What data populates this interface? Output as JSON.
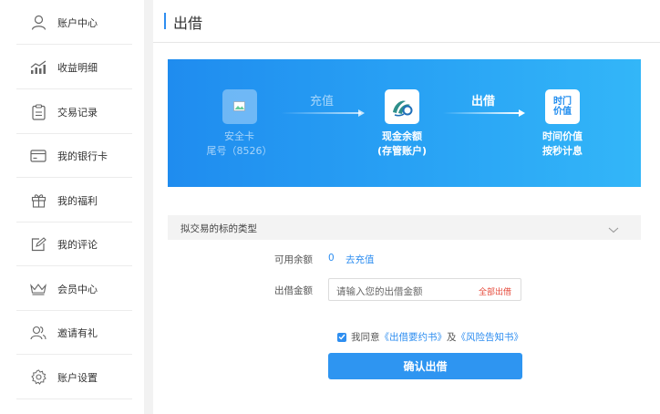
{
  "sidebar": {
    "items": [
      {
        "label": "账户中心",
        "icon": "user-icon"
      },
      {
        "label": "收益明细",
        "icon": "chart-icon"
      },
      {
        "label": "交易记录",
        "icon": "clipboard-icon"
      },
      {
        "label": "我的银行卡",
        "icon": "card-icon"
      },
      {
        "label": "我的福利",
        "icon": "gift-icon"
      },
      {
        "label": "我的评论",
        "icon": "edit-icon"
      },
      {
        "label": "会员中心",
        "icon": "crown-icon"
      },
      {
        "label": "邀请有礼",
        "icon": "users-icon"
      },
      {
        "label": "账户设置",
        "icon": "gear-icon"
      }
    ]
  },
  "header": {
    "title": "出借"
  },
  "banner": {
    "card": {
      "line1": "安全卡",
      "line2": "尾号（8526）"
    },
    "arrow1": "充值",
    "cash": {
      "line1": "现金余额",
      "line2": "(存管账户)"
    },
    "arrow2": "出借",
    "time": {
      "icon_line1": "时门",
      "icon_line2": "价值",
      "line1": "时间价值",
      "line2": "按秒计息"
    }
  },
  "form": {
    "type_dropdown": "拟交易的标的类型",
    "available_label": "可用余额",
    "available_value": "0",
    "recharge_link": "去充值",
    "amount_label": "出借金额",
    "amount_placeholder": "请输入您的出借金额",
    "all_label": "全部出借",
    "agree_prefix": "我同意",
    "agreement1": "《出借要约书》",
    "agree_and": "及",
    "agreement2": "《风险告知书》",
    "submit": "确认出借"
  },
  "colors": {
    "accent": "#2e8ef0",
    "warning": "#e64a3b"
  }
}
